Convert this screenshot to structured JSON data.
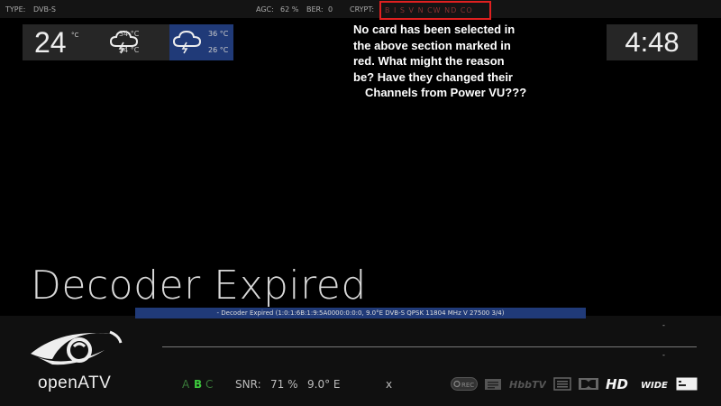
{
  "topbar": {
    "type_label": "TYPE:",
    "type_value": "DVB-S",
    "agc_label": "AGC:",
    "agc_value": "62 %",
    "ber_label": "BER:",
    "ber_value": "0",
    "crypt_label": "CRYPT:",
    "crypt_systems": "B  I  S  V  N  CW  ND  CO"
  },
  "weather": {
    "current_temp": "24",
    "unit": "°C",
    "day1_high": "34 °C",
    "day1_low": "24 °C",
    "day2_high": "36 °C",
    "day2_low": "26 °C",
    "icon": "cloud-lightning-icon",
    "selected_color": "#203a78"
  },
  "annotation": {
    "lines": [
      "No card has been selected in",
      "the above section marked in",
      "red. What might the reason",
      "be? Have they changed their",
      "Channels from Power VU???"
    ],
    "highlight_color": "#e02020"
  },
  "clock": {
    "time": "4:48"
  },
  "event": {
    "title": "Decoder Expired",
    "service_ref": "- Decoder Expired (1:0:1:6B:1:9:5A0000:0:0:0, 9.0°E DVB-S QPSK 11804 MHz V 27500 3/4)"
  },
  "infobar": {
    "dash_top": "-",
    "dash_bottom": "-",
    "abc": [
      "A",
      "B",
      "C"
    ],
    "abc_active": "B",
    "active_color": "#3cc83c",
    "snr_label": "SNR:",
    "snr_value": "71 %",
    "orbital": "9.0° E",
    "x_label": "x",
    "brand": "openATV",
    "rec_label": "REC",
    "hbbtv_label": "HbbTV",
    "hd_label": "HD",
    "wide_label": "WIDE"
  }
}
